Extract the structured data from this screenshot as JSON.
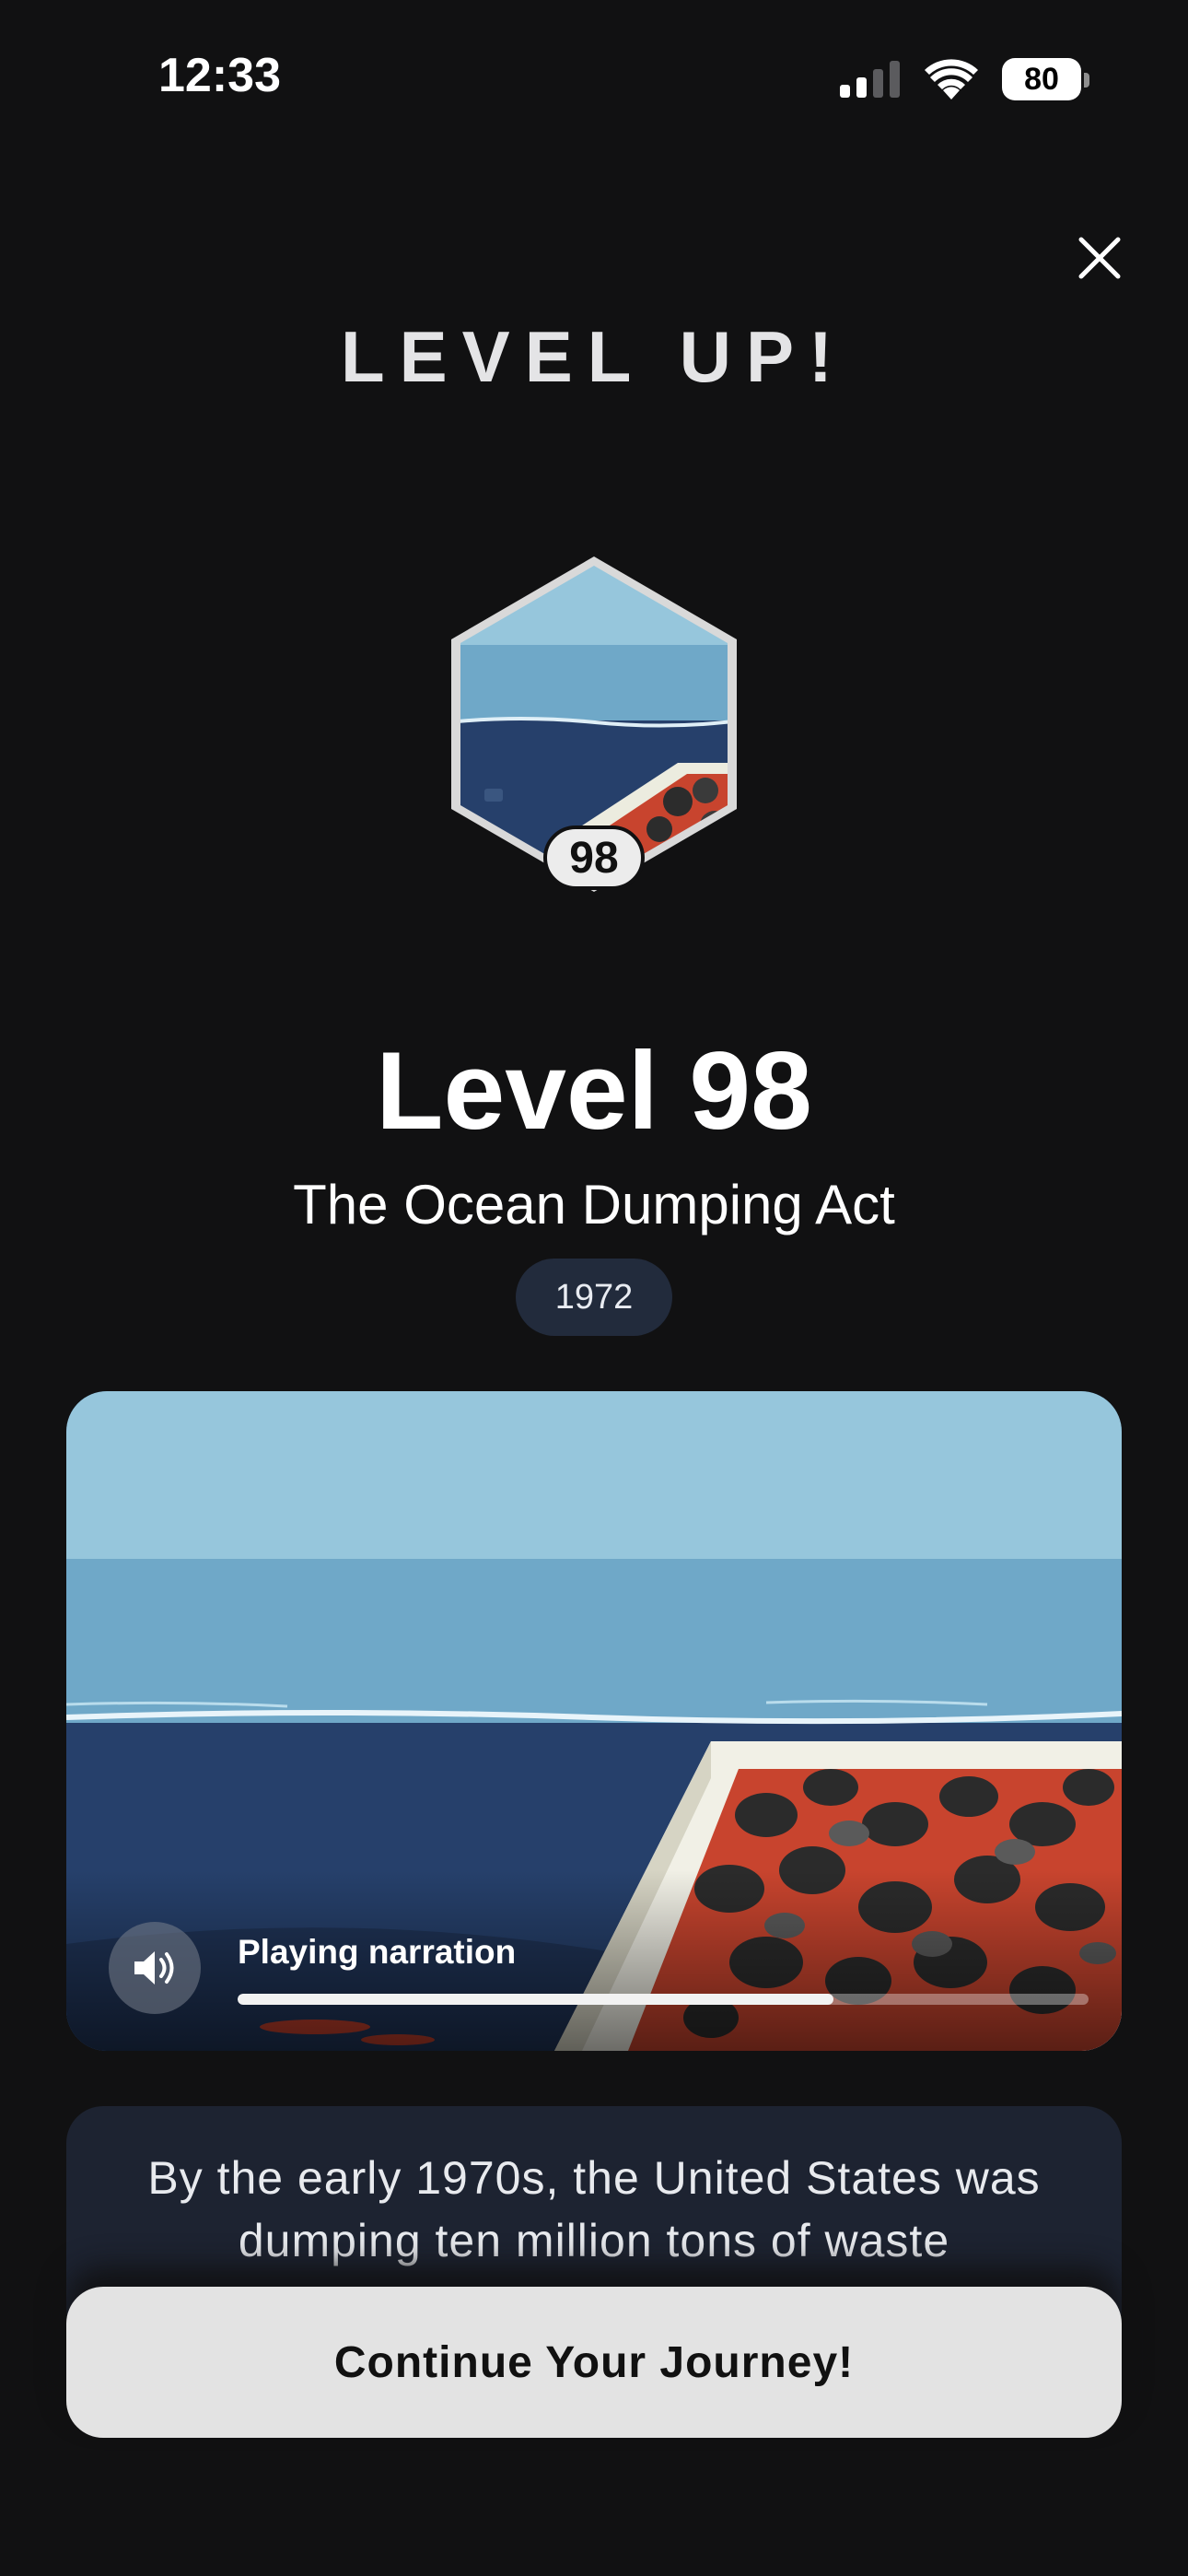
{
  "status_bar": {
    "time": "12:33",
    "battery": "80"
  },
  "heading": "LEVEL UP!",
  "badge": {
    "number": "98"
  },
  "level": {
    "title": "Level 98",
    "subtitle": "The Ocean Dumping Act",
    "year": "1972"
  },
  "media": {
    "narration_label": "Playing narration",
    "progress": 0.7
  },
  "description": {
    "text": "By the early 1970s, the United States was dumping ten million tons of waste"
  },
  "cta": {
    "label": "Continue Your Journey!"
  },
  "colors": {
    "background": "#111112",
    "sky": "#96c6dc",
    "sea_surface": "#6fa8c8",
    "deep_sea": "#26406b",
    "spill_red": "#c8442e",
    "pill_bg": "#222b3c",
    "card_bg": "#1d2331",
    "button_bg": "#e3e3e3"
  },
  "icons": {
    "close": "close-icon",
    "signal": "cellular-signal-icon",
    "wifi": "wifi-icon",
    "battery": "battery-icon",
    "speaker": "speaker-icon"
  }
}
